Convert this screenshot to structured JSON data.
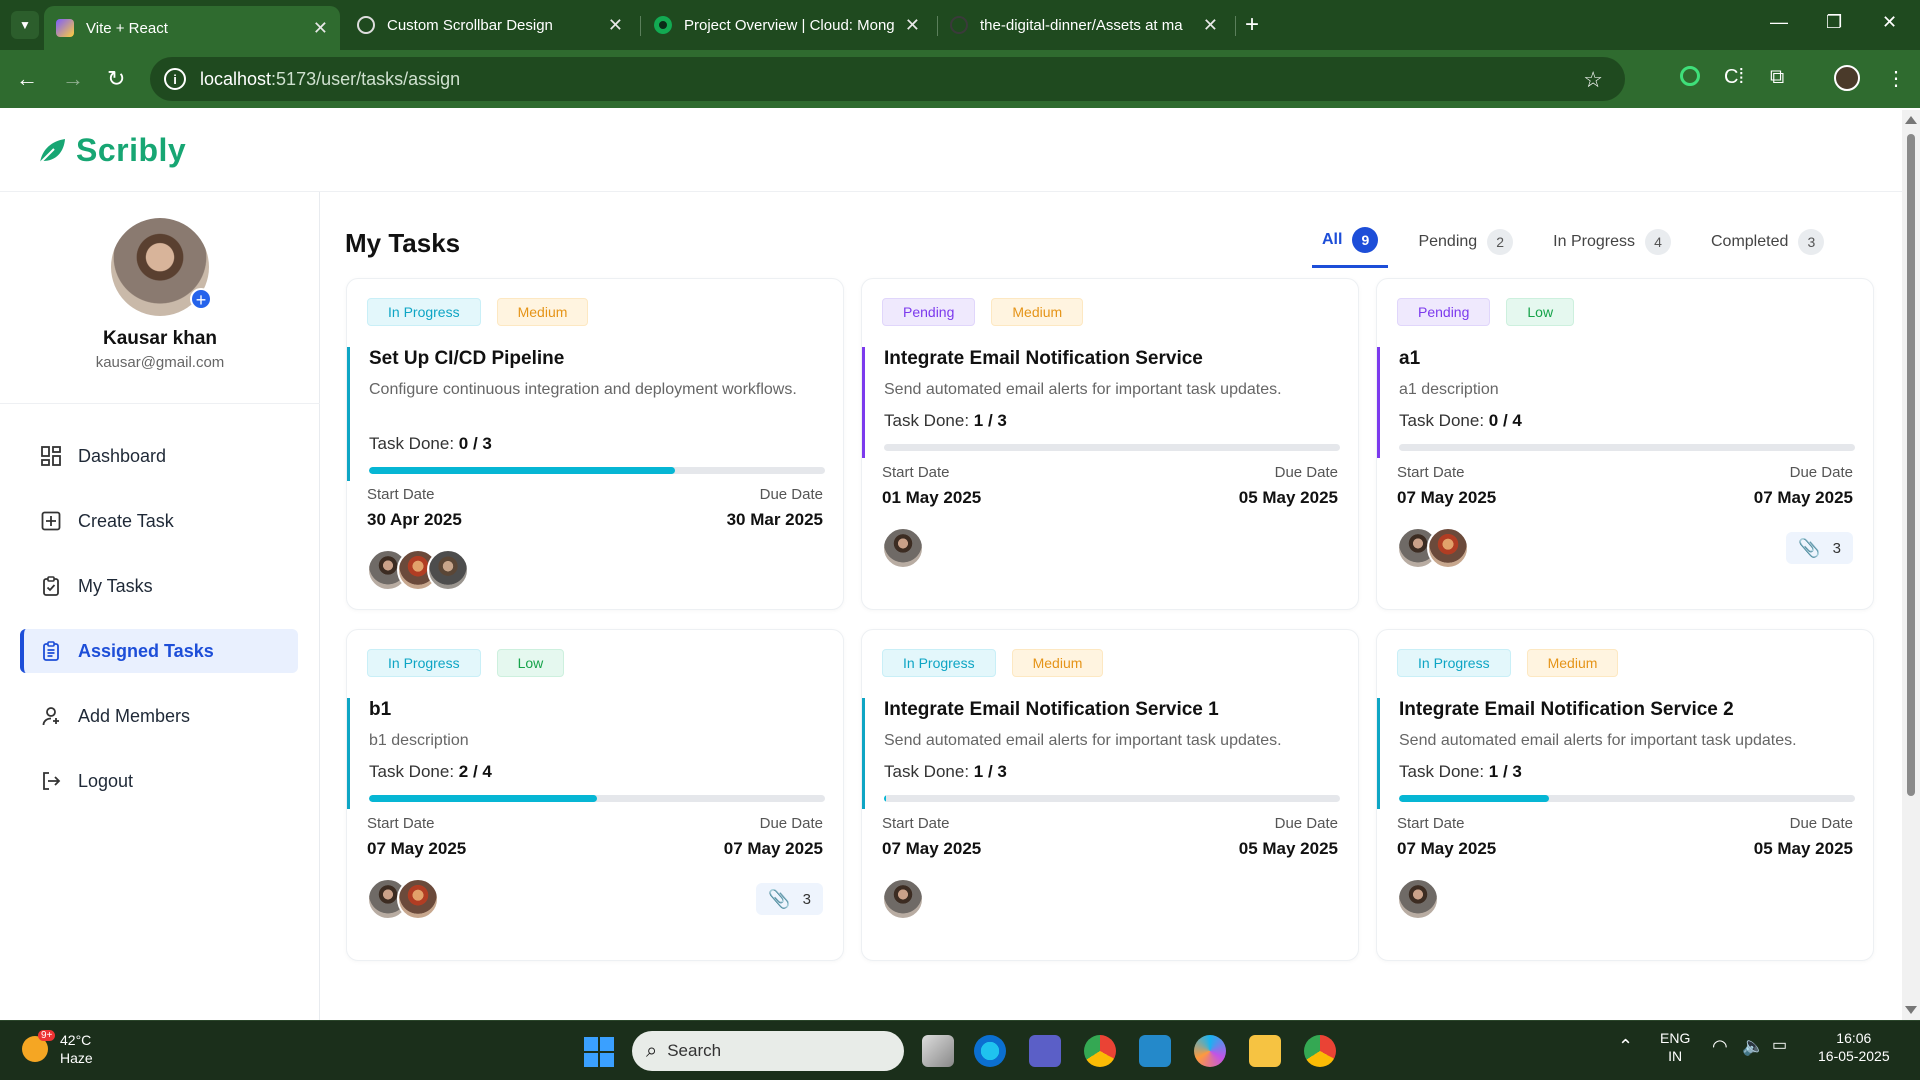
{
  "browser": {
    "tabs": [
      {
        "title": "Vite + React",
        "active": true
      },
      {
        "title": "Custom Scrollbar Design",
        "active": false
      },
      {
        "title": "Project Overview | Cloud: Mong",
        "active": false
      },
      {
        "title": "the-digital-dinner/Assets at ma",
        "active": false
      }
    ],
    "url_host": "localhost",
    "url_path": ":5173/user/tasks/assign"
  },
  "app": {
    "logo_text": "Scribly",
    "brand_color": "#17a673"
  },
  "user": {
    "name": "Kausar khan",
    "email": "kausar@gmail.com"
  },
  "sidebar": {
    "items": [
      {
        "label": "Dashboard",
        "icon": "grid-icon",
        "active": false
      },
      {
        "label": "Create Task",
        "icon": "plus-square-icon",
        "active": false
      },
      {
        "label": "My Tasks",
        "icon": "clipboard-check-icon",
        "active": false
      },
      {
        "label": "Assigned Tasks",
        "icon": "clipboard-list-icon",
        "active": true
      },
      {
        "label": "Add Members",
        "icon": "user-plus-icon",
        "active": false
      },
      {
        "label": "Logout",
        "icon": "logout-icon",
        "active": false
      }
    ]
  },
  "main": {
    "title": "My Tasks",
    "filters": [
      {
        "label": "All",
        "count": "9",
        "active": true
      },
      {
        "label": "Pending",
        "count": "2",
        "active": false
      },
      {
        "label": "In Progress",
        "count": "4",
        "active": false
      },
      {
        "label": "Completed",
        "count": "3",
        "active": false
      }
    ],
    "cards": [
      {
        "status": "In Progress",
        "priority": "Medium",
        "title": "Set Up CI/CD Pipeline",
        "description": "Configure continuous integration and deployment workflows.",
        "task_done_label": "Task Done:",
        "task_done": "0 / 3",
        "progress": 0.67,
        "start_label": "Start Date",
        "start": "30 Apr 2025",
        "due_label": "Due Date",
        "due": "30 Mar 2025",
        "avatars": 3,
        "attachments": ""
      },
      {
        "status": "Pending",
        "priority": "Medium",
        "title": "Integrate Email Notification Service",
        "description": "Send automated email alerts for important task updates.",
        "task_done_label": "Task Done:",
        "task_done": "1 / 3",
        "progress": 0,
        "start_label": "Start Date",
        "start": "01 May 2025",
        "due_label": "Due Date",
        "due": "05 May 2025",
        "avatars": 1,
        "attachments": ""
      },
      {
        "status": "Pending",
        "priority": "Low",
        "title": "a1",
        "description": "a1 description",
        "task_done_label": "Task Done:",
        "task_done": "0 / 4",
        "progress": 0,
        "start_label": "Start Date",
        "start": "07 May 2025",
        "due_label": "Due Date",
        "due": "07 May 2025",
        "avatars": 2,
        "attachments": "3"
      },
      {
        "status": "In Progress",
        "priority": "Low",
        "title": "b1",
        "description": "b1 description",
        "task_done_label": "Task Done:",
        "task_done": "2 / 4",
        "progress": 0.5,
        "start_label": "Start Date",
        "start": "07 May 2025",
        "due_label": "Due Date",
        "due": "07 May 2025",
        "avatars": 2,
        "attachments": "3"
      },
      {
        "status": "In Progress",
        "priority": "Medium",
        "title": "Integrate Email Notification Service 1",
        "description": "Send automated email alerts for important task updates.",
        "task_done_label": "Task Done:",
        "task_done": "1 / 3",
        "progress": 0.005,
        "start_label": "Start Date",
        "start": "07 May 2025",
        "due_label": "Due Date",
        "due": "05 May 2025",
        "avatars": 1,
        "attachments": ""
      },
      {
        "status": "In Progress",
        "priority": "Medium",
        "title": "Integrate Email Notification Service 2",
        "description": "Send automated email alerts for important task updates.",
        "task_done_label": "Task Done:",
        "task_done": "1 / 3",
        "progress": 0.33,
        "start_label": "Start Date",
        "start": "07 May 2025",
        "due_label": "Due Date",
        "due": "05 May 2025",
        "avatars": 1,
        "attachments": ""
      }
    ]
  },
  "taskbar": {
    "weather_temp": "42°C",
    "weather_desc": "Haze",
    "weather_badge": "9+",
    "search_placeholder": "Search",
    "lang": "ENG",
    "region": "IN",
    "time": "16:06",
    "date": "16-05-2025"
  }
}
